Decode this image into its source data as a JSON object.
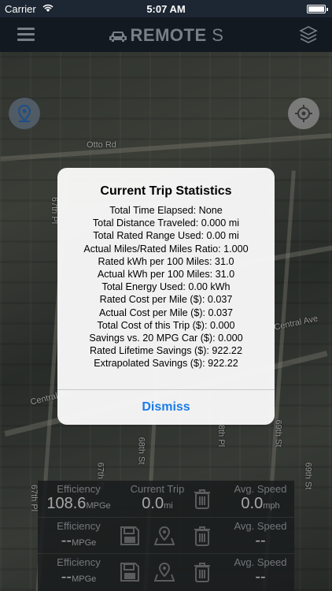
{
  "status_bar": {
    "carrier": "Carrier",
    "time": "5:07 AM"
  },
  "nav": {
    "title": "REMOTE",
    "title_suffix": "S",
    "menu_icon": "hamburger-icon",
    "layers_icon": "layers-icon"
  },
  "map": {
    "labels": [
      "Otto Rd",
      "67th Pl",
      "67th Pl",
      "Central Ave",
      "Central Ave",
      "68th St",
      "68th Pl",
      "69th St",
      "67th St",
      "69th St"
    ]
  },
  "alert": {
    "title": "Current Trip Statistics",
    "lines": [
      "Total Time Elapsed: None",
      "Total Distance Traveled: 0.000 mi",
      "Total Rated Range Used: 0.00 mi",
      "Actual Miles/Rated Miles Ratio: 1.000",
      "Rated kWh per 100 Miles: 31.0",
      "Actual kWh per 100 Miles: 31.0",
      "Total Energy Used: 0.00 kWh",
      "Rated Cost per Mile ($): 0.037",
      "Actual Cost per Mile ($): 0.037",
      "Total Cost of this Trip ($): 0.000",
      "Savings vs. 20 MPG Car ($): 0.000",
      "Rated Lifetime Savings ($): 922.22",
      "Extrapolated Savings ($): 922.22"
    ],
    "dismiss_label": "Dismiss"
  },
  "stats_panel": {
    "rows": [
      {
        "efficiency_label": "Efficiency",
        "efficiency_value": "108.6",
        "efficiency_unit": "MPGe",
        "middle_label": "Current Trip",
        "middle_value": "0.0",
        "middle_unit": "mi",
        "speed_label": "Avg. Speed",
        "speed_value": "0.0",
        "speed_unit": "mph"
      },
      {
        "efficiency_label": "Efficiency",
        "efficiency_value": "--",
        "efficiency_unit": "MPGe",
        "speed_label": "Avg. Speed",
        "speed_value": "--"
      },
      {
        "efficiency_label": "Efficiency",
        "efficiency_value": "--",
        "efficiency_unit": "MPGe",
        "speed_label": "Avg. Speed",
        "speed_value": "--"
      }
    ]
  }
}
